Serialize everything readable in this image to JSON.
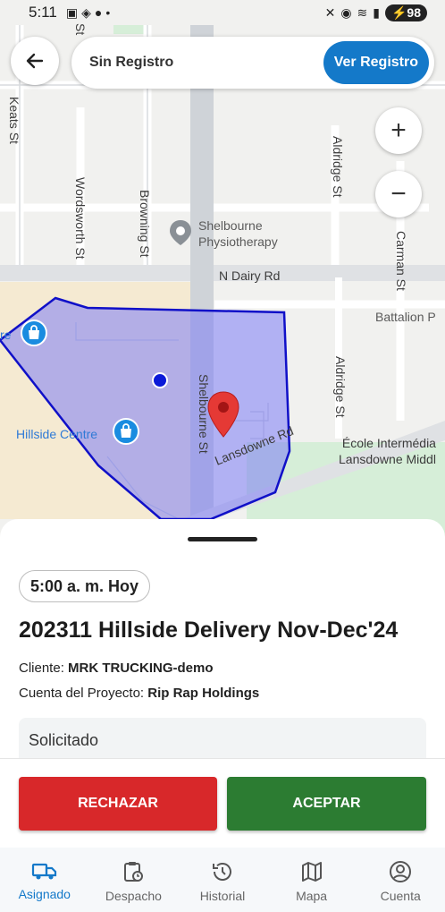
{
  "status_bar": {
    "time": "5:11",
    "battery": "98"
  },
  "map": {
    "streets": {
      "keats": "Keats St",
      "wordsworth": "Wordsworth St",
      "browning": "Browning St",
      "aldridge_top": "Aldridge St",
      "aldridge_bottom": "Aldridge St",
      "carman": "Carman St",
      "n_dairy": "N Dairy Rd",
      "shelbourne": "Shelbourne St",
      "lansdowne": "Lansdowne Rd",
      "top_cut": "St"
    },
    "places": {
      "physio_1": "Shelbourne",
      "physio_2": "Physiotherapy",
      "battalion": "Battalion P",
      "centre_cut": "re",
      "hillside": "Hillside Centre",
      "ecole_1": "École Intermédia",
      "ecole_2": "Lansdowne Middl"
    }
  },
  "header": {
    "left_label": "Sin Registro",
    "right_button": "Ver Registro"
  },
  "zoom": {
    "in": "+",
    "out": "−"
  },
  "job": {
    "time_chip": "5:00 a. m. Hoy",
    "title": "202311 Hillside Delivery Nov-Dec'24",
    "client_label": "Cliente:",
    "client_value": "MRK TRUCKING-demo",
    "account_label": "Cuenta del Proyecto:",
    "account_value": "Rip Rap Holdings",
    "status": "Solicitado"
  },
  "actions": {
    "reject": "RECHAZAR",
    "accept": "ACEPTAR"
  },
  "nav": [
    {
      "label": "Asignado",
      "icon": "truck-icon"
    },
    {
      "label": "Despacho",
      "icon": "clipboard-clock-icon"
    },
    {
      "label": "Historial",
      "icon": "history-icon"
    },
    {
      "label": "Mapa",
      "icon": "map-icon"
    },
    {
      "label": "Cuenta",
      "icon": "account-icon"
    }
  ],
  "colors": {
    "accent": "#1479c9",
    "reject": "#d8282a",
    "accept": "#2c7c32",
    "geofence_fill": "#7b7bf5",
    "geofence_stroke": "#1010c8",
    "pin": "#e53935"
  }
}
